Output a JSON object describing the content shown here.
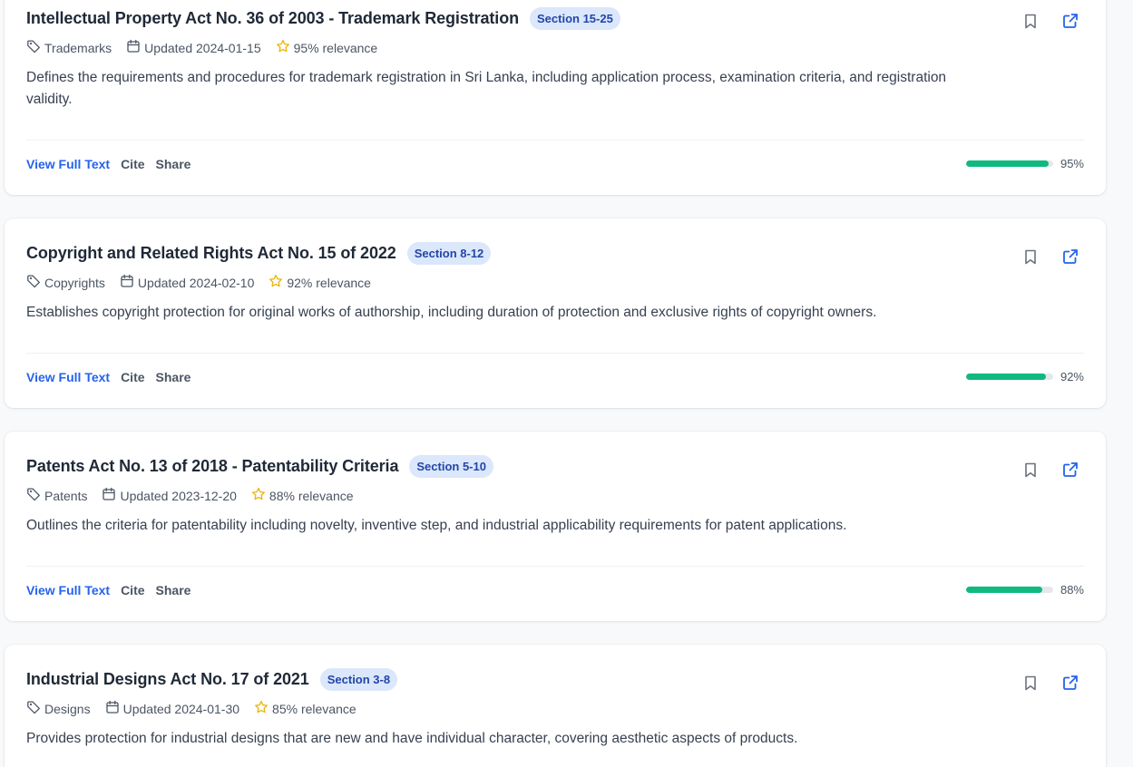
{
  "results": [
    {
      "title": "Intellectual Property Act No. 36 of 2003 - Trademark Registration",
      "section": "Section 15-25",
      "category": "Trademarks",
      "updated": "Updated 2024-01-15",
      "relevance_label": "95% relevance",
      "description": "Defines the requirements and procedures for trademark registration in Sri Lanka, including application process, examination criteria, and registration validity.",
      "relevance_value": 95,
      "relevance_percent": "95%"
    },
    {
      "title": "Copyright and Related Rights Act No. 15 of 2022",
      "section": "Section 8-12",
      "category": "Copyrights",
      "updated": "Updated 2024-02-10",
      "relevance_label": "92% relevance",
      "description": "Establishes copyright protection for original works of authorship, including duration of protection and exclusive rights of copyright owners.",
      "relevance_value": 92,
      "relevance_percent": "92%"
    },
    {
      "title": "Patents Act No. 13 of 2018 - Patentability Criteria",
      "section": "Section 5-10",
      "category": "Patents",
      "updated": "Updated 2023-12-20",
      "relevance_label": "88% relevance",
      "description": "Outlines the criteria for patentability including novelty, inventive step, and industrial applicability requirements for patent applications.",
      "relevance_value": 88,
      "relevance_percent": "88%"
    },
    {
      "title": "Industrial Designs Act No. 17 of 2021",
      "section": "Section 3-8",
      "category": "Designs",
      "updated": "Updated 2024-01-30",
      "relevance_label": "85% relevance",
      "description": "Provides protection for industrial designs that are new and have individual character, covering aesthetic aspects of products."
    }
  ],
  "actions": {
    "view_full_text": "View Full Text",
    "cite": "Cite",
    "share": "Share"
  },
  "icons": {
    "tag": "tag-icon",
    "calendar": "calendar-icon",
    "star": "star-icon",
    "bookmark": "bookmark-icon",
    "external": "external-link-icon"
  },
  "colors": {
    "accent": "#2563eb",
    "badge_bg": "#dbe7fb",
    "badge_text": "#2346a8",
    "progress": "#10b981",
    "star": "#eab308"
  }
}
